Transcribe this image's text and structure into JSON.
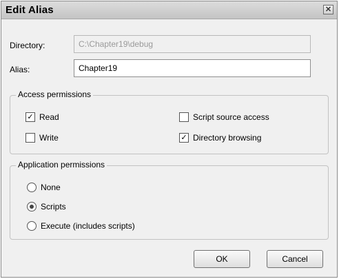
{
  "window": {
    "title": "Edit Alias",
    "close_glyph": "✕"
  },
  "form": {
    "directory_label": "Directory:",
    "directory_value": "C:\\Chapter19\\debug",
    "alias_label": "Alias:",
    "alias_value": "Chapter19"
  },
  "access_permissions": {
    "legend": "Access permissions",
    "options": [
      {
        "label": "Read",
        "checked": true
      },
      {
        "label": "Script source access",
        "checked": false
      },
      {
        "label": "Write",
        "checked": false
      },
      {
        "label": "Directory browsing",
        "checked": true
      }
    ],
    "check_glyph": "✓"
  },
  "application_permissions": {
    "legend": "Application permissions",
    "options": [
      {
        "label": "None",
        "selected": false
      },
      {
        "label": "Scripts",
        "selected": true
      },
      {
        "label": "Execute (includes scripts)",
        "selected": false
      }
    ]
  },
  "buttons": {
    "ok": "OK",
    "cancel": "Cancel"
  }
}
